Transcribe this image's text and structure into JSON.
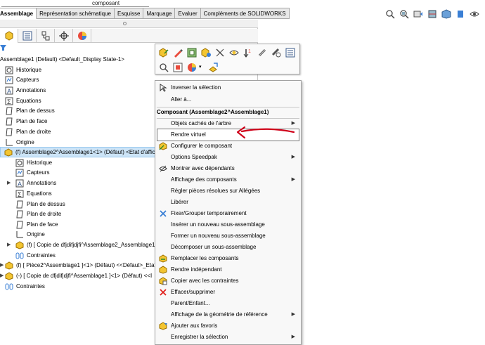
{
  "topstrip": {
    "label": "composant"
  },
  "tabs": [
    {
      "label": "Assemblage",
      "active": true
    },
    {
      "label": "Représentation schématique"
    },
    {
      "label": "Esquisse"
    },
    {
      "label": "Marquage"
    },
    {
      "label": "Evaluer"
    },
    {
      "label": "Compléments de SOLIDWORKS"
    }
  ],
  "tree": {
    "root": "Assemblage1 (Default) <Default_Display State-1>",
    "items": [
      "Historique",
      "Capteurs",
      "Annotations",
      "Equations",
      "Plan de dessus",
      "Plan de face",
      "Plan de droite",
      "Origine",
      "(f) Assemblage2^Assemblage1<1> (Défaut) <Etat d'affic",
      "Historique",
      "Capteurs",
      "Annotations",
      "Equations",
      "Plan de dessus",
      "Plan de droite",
      "Plan de face",
      "Origine",
      "(f) [ Copie de dfjdifjdjfi^Assemblage2_Assemblage1",
      "Contraintes",
      "(f) [ Pièce2^Assemblage1 ]<1> (Défaut) <<Défaut>_Etat",
      "(-) [ Copie de dfjdifjdjfi^Assemblage1 ]<1> (Défaut) <<I",
      "Contraintes"
    ]
  },
  "menu": {
    "items": [
      {
        "label": "Inverser la sélection"
      },
      {
        "label": "Aller à..."
      },
      {
        "label": "Composant (Assemblage2^Assemblage1)"
      },
      {
        "label": "Objets cachés de l'arbre"
      },
      {
        "label": "Rendre virtuel"
      },
      {
        "label": "Configurer le composant"
      },
      {
        "label": "Options Speedpak"
      },
      {
        "label": "Montrer avec dépendants"
      },
      {
        "label": "Affichage des composants"
      },
      {
        "label": "Régler pièces résolues sur Allégées"
      },
      {
        "label": "Libérer"
      },
      {
        "label": "Fixer/Grouper temporairement"
      },
      {
        "label": "Insérer un nouveau sous-assemblage"
      },
      {
        "label": "Former un nouveau sous-assemblage"
      },
      {
        "label": "Décomposer un sous-assemblage"
      },
      {
        "label": "Remplacer les composants"
      },
      {
        "label": "Rendre indépendant"
      },
      {
        "label": "Copier avec les contraintes"
      },
      {
        "label": "Effacer/supprimer"
      },
      {
        "label": "Parent/Enfant..."
      },
      {
        "label": "Affichage de la géométrie de référence"
      },
      {
        "label": "Ajouter aux favoris"
      },
      {
        "label": "Enregistrer la sélection"
      }
    ]
  },
  "colors": {
    "selection": "#cce4f7",
    "annotation_red": "#d0021b",
    "accent_yellow": "#f3c531"
  }
}
